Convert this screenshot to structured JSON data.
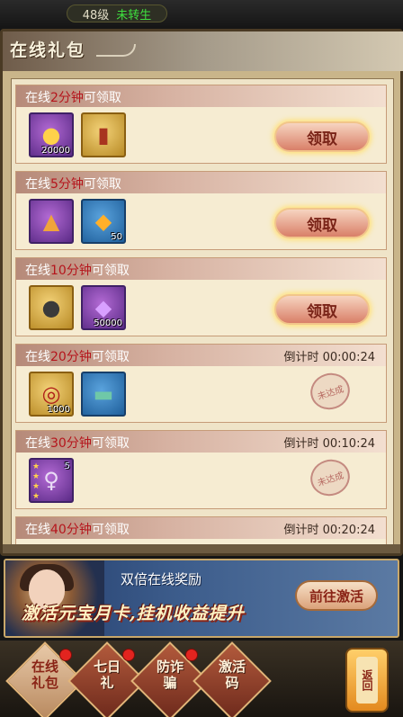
{
  "player": {
    "level": "48级",
    "rebirth": "未转生"
  },
  "panel": {
    "title": "在线礼包"
  },
  "rewards": [
    {
      "prefix": "在线",
      "minutes": "2分钟",
      "suffix": "可领取",
      "countdown": "",
      "items": [
        {
          "icon": "gold-coins-icon",
          "qty": "20000"
        },
        {
          "icon": "potion-bottle-icon",
          "qty": ""
        }
      ],
      "status": "claimable",
      "claim_label": "领取"
    },
    {
      "prefix": "在线",
      "minutes": "5分钟",
      "suffix": "可领取",
      "countdown": "",
      "items": [
        {
          "icon": "helmet-icon",
          "qty": ""
        },
        {
          "icon": "orange-gem-icon",
          "qty": "50"
        }
      ],
      "status": "claimable",
      "claim_label": "领取"
    },
    {
      "prefix": "在线",
      "minutes": "10分钟",
      "suffix": "可领取",
      "countdown": "",
      "items": [
        {
          "icon": "iron-ball-icon",
          "qty": ""
        },
        {
          "icon": "purple-crystal-icon",
          "qty": "50000"
        }
      ],
      "status": "claimable",
      "claim_label": "领取"
    },
    {
      "prefix": "在线",
      "minutes": "20分钟",
      "suffix": "可领取",
      "countdown": "倒计时 00:00:24",
      "items": [
        {
          "icon": "gold-medal-icon",
          "qty": "1000"
        },
        {
          "icon": "treasure-chest-icon",
          "qty": ""
        }
      ],
      "status": "pending",
      "stamp": "未达成"
    },
    {
      "prefix": "在线",
      "minutes": "30分钟",
      "suffix": "可领取",
      "countdown": "倒计时 00:10:24",
      "items": [
        {
          "icon": "star-character-card-icon",
          "qty": "5"
        }
      ],
      "status": "pending",
      "stamp": "未达成"
    },
    {
      "prefix": "在线",
      "minutes": "40分钟",
      "suffix": "可领取",
      "countdown": "倒计时 00:20:24",
      "items": [],
      "status": "pending"
    }
  ],
  "banner": {
    "subtitle": "双倍在线奖励",
    "headline": "激活元宝月卡,挂机收益提升",
    "button": "前往激活"
  },
  "nav": {
    "tabs": [
      {
        "label": "在线礼包",
        "badge": true,
        "active": true
      },
      {
        "label": "七日礼",
        "badge": true,
        "active": false
      },
      {
        "label": "防诈骗",
        "badge": true,
        "active": false
      },
      {
        "label": "激活码",
        "badge": false,
        "active": false
      }
    ],
    "back": "返回"
  },
  "colors": {
    "minutes_highlight": "#b5151c",
    "rebirth": "#3fe03f",
    "claim_glow": "#ffe27a"
  }
}
